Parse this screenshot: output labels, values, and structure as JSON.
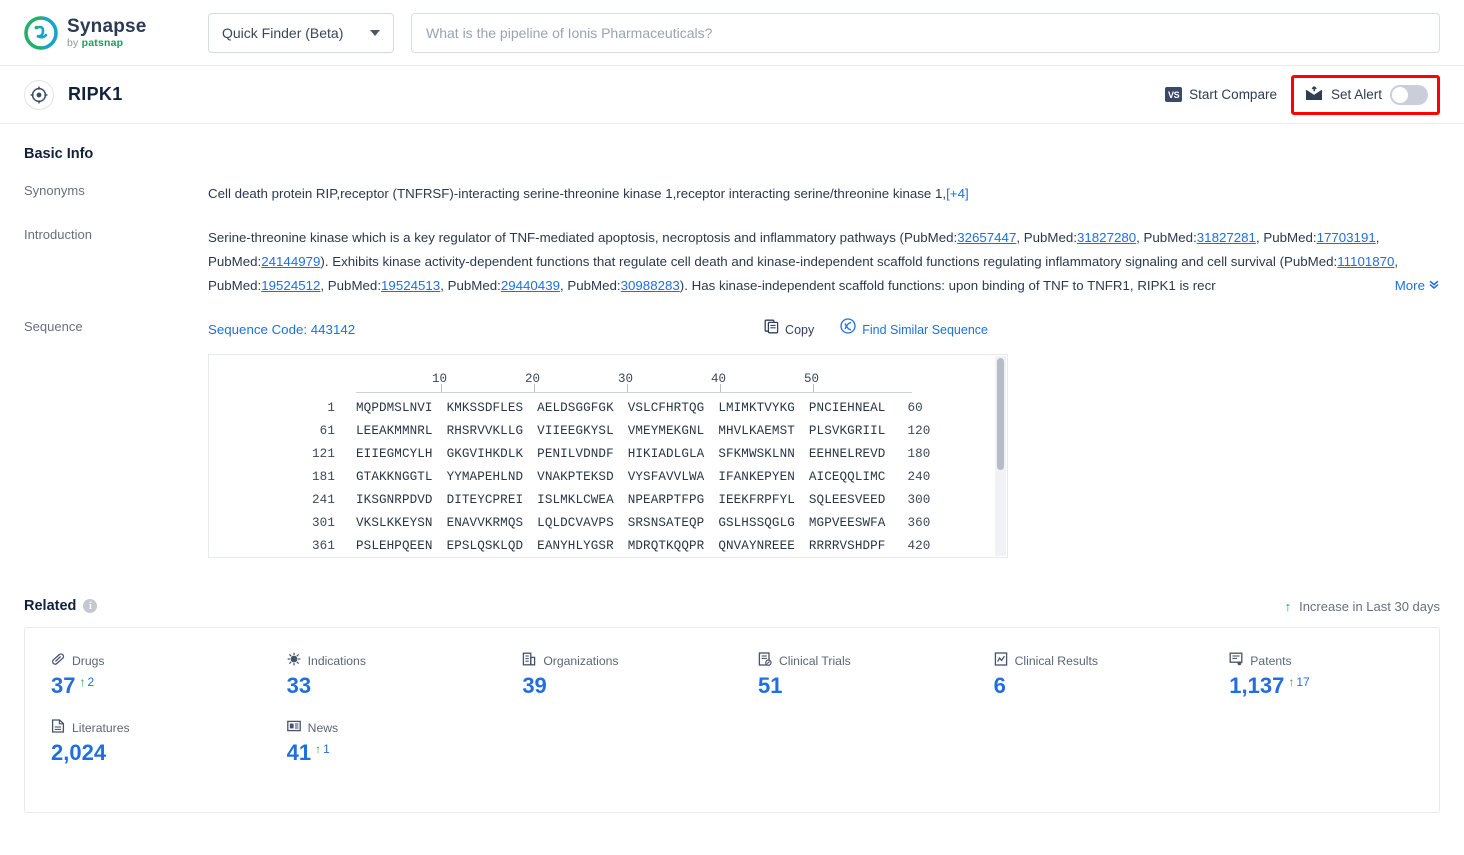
{
  "brand": {
    "name": "Synapse",
    "by": "by ",
    "company": "patsnap"
  },
  "topbar": {
    "finder_label": "Quick Finder (Beta)",
    "search_placeholder": "What is the pipeline of Ionis Pharmaceuticals?",
    "search_value": ""
  },
  "entity": {
    "title": "RIPK1",
    "icon": "target-icon",
    "compare_label": "Start Compare",
    "compare_badge": "VS",
    "alert_label": "Set Alert",
    "alert_on": false,
    "highlight_color": "#ff0000"
  },
  "basic_info": {
    "heading": "Basic Info",
    "synonyms_label": "Synonyms",
    "synonyms_text": "Cell death protein RIP,receptor (TNFRSF)-interacting serine-threonine kinase 1,receptor interacting serine/threonine kinase 1,",
    "synonyms_more": "[+4]",
    "introduction_label": "Introduction",
    "introduction_p1_a": "Serine-threonine kinase which is a key regulator of TNF-mediated apoptosis, necroptosis and inflammatory pathways (PubMed:",
    "introduction_pmids_1": [
      "32657447",
      "31827280",
      "31827281",
      "17703191",
      "24144979"
    ],
    "introduction_p2": "). Exhibits kinase activity-dependent functions that regulate cell death and kinase-independent scaffold functions regulating inflammatory signaling and cell survival (PubMed:",
    "introduction_pmids_2": [
      "11101870",
      "19524512",
      "19524513",
      "29440439",
      "30988283"
    ],
    "introduction_p3": "). Has kinase-independent scaffold functions: upon binding of TNF to TNFR1, RIPK1 is recr",
    "more_label": "More",
    "pubmed_prefix": "PubMed:"
  },
  "sequence": {
    "label": "Sequence",
    "code_label": "Sequence Code: 443142",
    "copy_label": "Copy",
    "similar_label": "Find Similar Sequence",
    "ruler": [
      "10",
      "20",
      "30",
      "40",
      "50"
    ],
    "rows": [
      {
        "start": "1",
        "end": "60",
        "blocks": [
          "MQPDMSLNVI",
          "KMKSSDFLES",
          "AELDSGGFGK",
          "VSLCFHRTQG",
          "LMIMKTVYKG",
          "PNCIEHNEAL"
        ]
      },
      {
        "start": "61",
        "end": "120",
        "blocks": [
          "LEEAKMMNRL",
          "RHSRVVKLLG",
          "VIIEEGKYSL",
          "VMEYMEKGNL",
          "MHVLKAEMST",
          "PLSVKGRIIL"
        ]
      },
      {
        "start": "121",
        "end": "180",
        "blocks": [
          "EIIEGMCYLH",
          "GKGVIHKDLK",
          "PENILVDNDF",
          "HIKIADLGLA",
          "SFKMWSKLNN",
          "EEHNELREVD"
        ]
      },
      {
        "start": "181",
        "end": "240",
        "blocks": [
          "GTAKKNGGTL",
          "YYMAPEHLND",
          "VNAKPTEKSD",
          "VYSFAVVLWA",
          "IFANKEPYEN",
          "AICEQQLIMC"
        ]
      },
      {
        "start": "241",
        "end": "300",
        "blocks": [
          "IKSGNRPDVD",
          "DITEYCPREI",
          "ISLMKLCWEA",
          "NPEARPTFPG",
          "IEEKFRPFYL",
          "SQLEESVEED"
        ]
      },
      {
        "start": "301",
        "end": "360",
        "blocks": [
          "VKSLKKEYSN",
          "ENAVVKRMQS",
          "LQLDCVAVPS",
          "SRSNSATEQP",
          "GSLHSSQGLG",
          "MGPVEESWFA"
        ]
      },
      {
        "start": "361",
        "end": "420",
        "blocks": [
          "PSLEHPQEEN",
          "EPSLQSKLQD",
          "EANYHLYGSR",
          "MDRQTKQQPR",
          "QNVAYNREEE",
          "RRRRVSHDPF"
        ]
      }
    ]
  },
  "related": {
    "heading": "Related",
    "increase_note": "Increase in Last 30 days",
    "items": [
      {
        "label": "Drugs",
        "icon": "pill-icon",
        "value": "37",
        "delta": "2"
      },
      {
        "label": "Indications",
        "icon": "virus-icon",
        "value": "33",
        "delta": ""
      },
      {
        "label": "Organizations",
        "icon": "building-icon",
        "value": "39",
        "delta": ""
      },
      {
        "label": "Clinical Trials",
        "icon": "clinical-trial-icon",
        "value": "51",
        "delta": ""
      },
      {
        "label": "Clinical Results",
        "icon": "clinical-result-icon",
        "value": "6",
        "delta": ""
      },
      {
        "label": "Patents",
        "icon": "patent-icon",
        "value": "1,137",
        "delta": "17"
      },
      {
        "label": "Literatures",
        "icon": "literature-icon",
        "value": "2,024",
        "delta": ""
      },
      {
        "label": "News",
        "icon": "news-icon",
        "value": "41",
        "delta": "1"
      }
    ]
  },
  "colors": {
    "accent": "#1f6fe0",
    "green": "#2aa141",
    "dark": "#13203a"
  }
}
